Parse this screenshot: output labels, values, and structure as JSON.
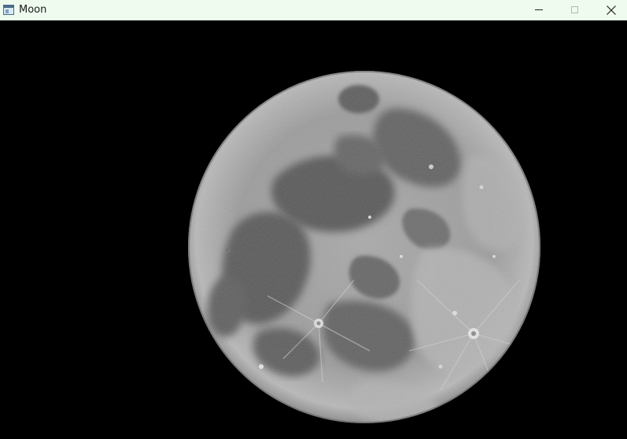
{
  "window": {
    "title": "Moon",
    "icons": {
      "app": "app-window-icon",
      "minimize": "minimize-icon",
      "maximize": "maximize-icon",
      "close": "close-icon"
    },
    "colors": {
      "titlebar_bg": "#eefbee",
      "content_bg": "#000000"
    }
  },
  "content": {
    "image_subject": "moon-photo"
  }
}
